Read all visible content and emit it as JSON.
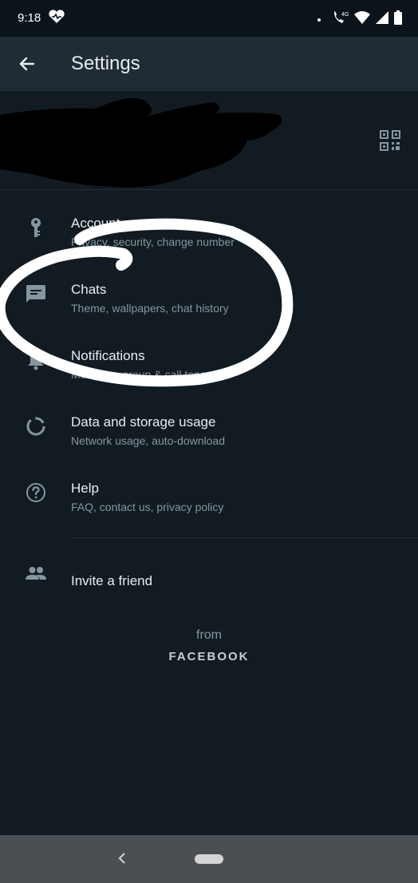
{
  "status_bar": {
    "time": "9:18",
    "network_label": "4G"
  },
  "app_bar": {
    "title": "Settings"
  },
  "menu": [
    {
      "label": "Account",
      "sub": "Privacy, security, change number",
      "icon": "key-icon"
    },
    {
      "label": "Chats",
      "sub": "Theme, wallpapers, chat history",
      "icon": "chat-icon"
    },
    {
      "label": "Notifications",
      "sub": "Message, group & call tones",
      "icon": "bell-icon"
    },
    {
      "label": "Data and storage usage",
      "sub": "Network usage, auto-download",
      "icon": "storage-circle-icon"
    },
    {
      "label": "Help",
      "sub": "FAQ, contact us, privacy policy",
      "icon": "help-icon"
    }
  ],
  "invite": {
    "label": "Invite a friend",
    "icon": "people-icon"
  },
  "footer": {
    "from": "from",
    "brand": "FACEBOOK"
  },
  "colors": {
    "background": "#111b21",
    "app_bar": "#1f2c34",
    "text_primary": "#e9edef",
    "text_secondary": "#8696a0",
    "icon": "#8696a0"
  }
}
